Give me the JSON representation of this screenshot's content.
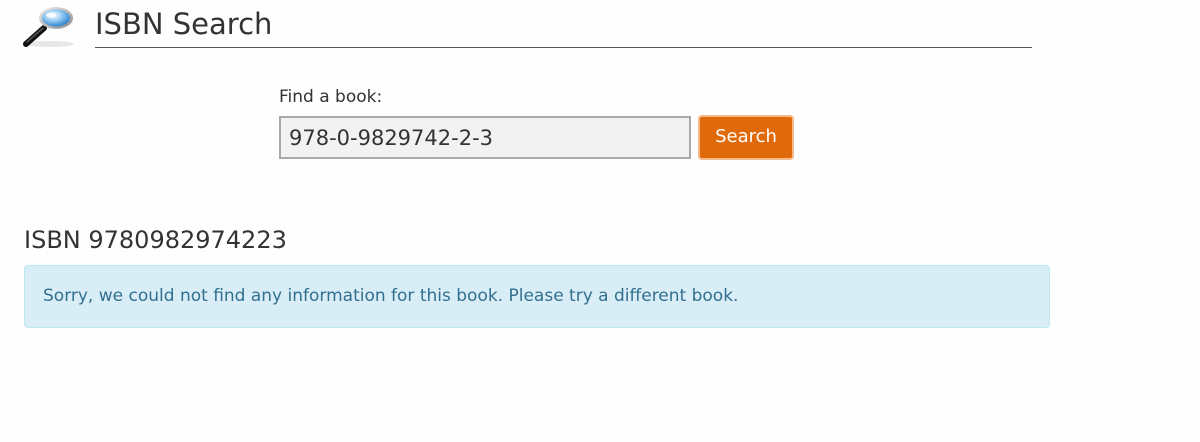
{
  "header": {
    "logo_icon": "magnifying-glass-icon",
    "title": "ISBN Search"
  },
  "search": {
    "label": "Find a book:",
    "value": "978-0-9829742-2-3",
    "button_label": "Search",
    "button_color": "#e06a0a"
  },
  "result": {
    "heading": "ISBN 9780982974223",
    "message": "Sorry, we could not find any information for this book. Please try a different book.",
    "alert_color": "#d9edf7",
    "message_color": "#31708f"
  }
}
